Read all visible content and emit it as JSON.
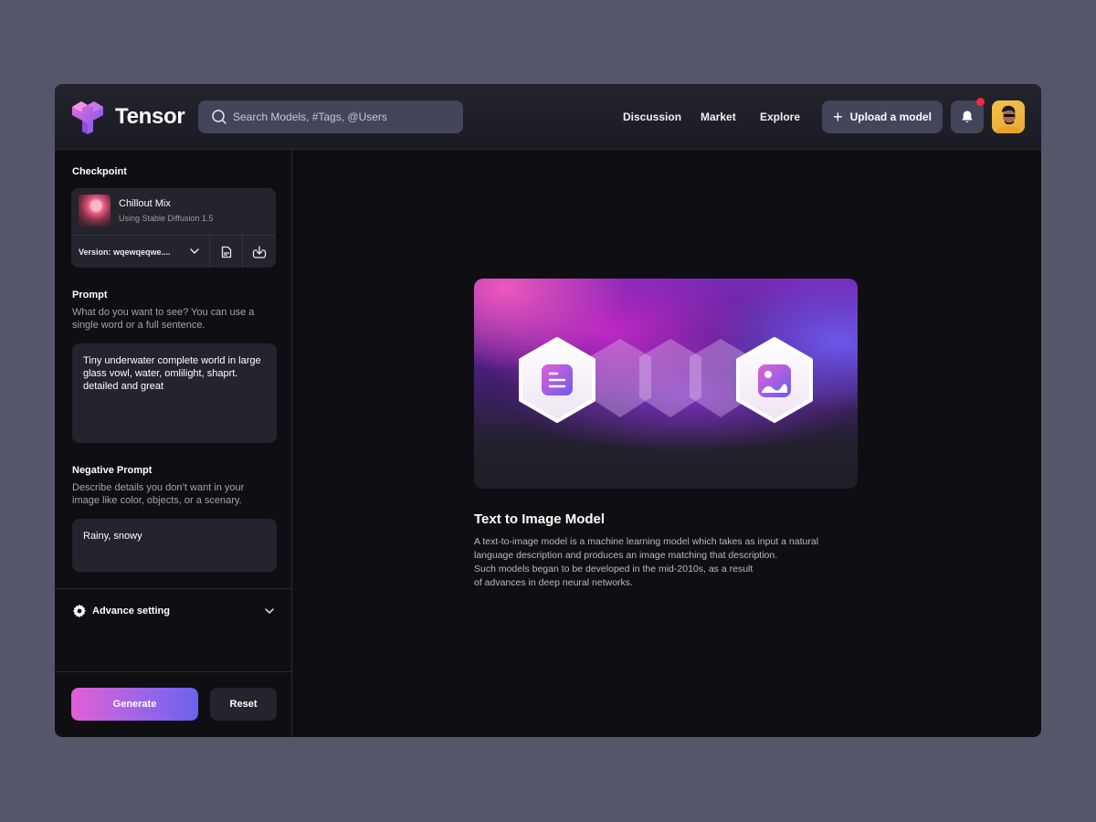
{
  "header": {
    "brand": "Tensor",
    "search_placeholder": "Search Models, #Tags, @Users",
    "nav": [
      "Discussion",
      "Market",
      "Explore"
    ],
    "upload_label": "Upload a model",
    "notification_badge": true,
    "accent_colors": {
      "pink": "#e060d6",
      "violet": "#6a63ee",
      "badge": "#ef2d3c"
    }
  },
  "sidebar": {
    "checkpoint": {
      "label": "Checkpoint",
      "model_name": "Chillout Mix",
      "model_sub": "Using Stable Diffusion 1.5",
      "version": "Version: wqewqeqwe...."
    },
    "prompt": {
      "label": "Prompt",
      "description": "What do you want to see? You can use a single word or a full sentence.",
      "value": "Tiny underwater complete world in large glass vowl, water, omlilight, shaprt. detailed and great"
    },
    "negative_prompt": {
      "label": "Negative Prompt",
      "description": "Describe details you don’t want in your image like color, objects, or a scenary.",
      "value": "Rainy, snowy"
    },
    "advance_setting": "Advance setting",
    "generate_label": "Generate",
    "reset_label": "Reset"
  },
  "main": {
    "title": "Text to Image Model",
    "body": "A text-to-image model is a machine learning model which takes as input a natural\nlanguage description and produces an image matching that description.\nSuch models began to be developed in the mid-2010s, as a result\n of advances in deep neural networks."
  }
}
